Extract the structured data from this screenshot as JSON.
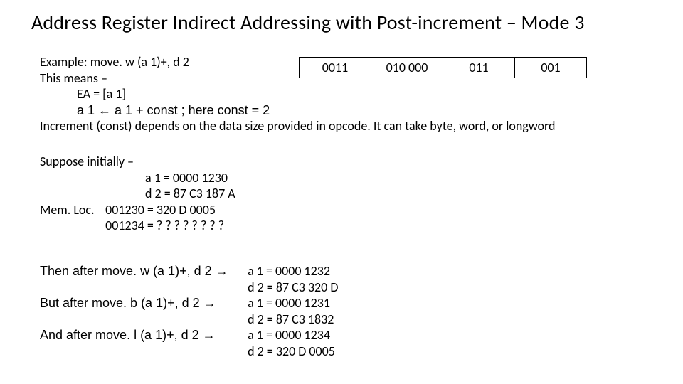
{
  "title": "Address Register Indirect Addressing with Post-increment – Mode 3",
  "example": {
    "line1": "Example:  move. w (a 1)+, d 2",
    "line2": "This means –",
    "ea": "EA = [a 1]",
    "inc": "a 1 ←  a 1 + const   ; here const = 2",
    "desc": "Increment (const) depends on the data size provided in opcode. It can take byte, word, or longword"
  },
  "opcode": {
    "c1": "0011",
    "c2": "010 000",
    "c3": "011",
    "c4": "001"
  },
  "initial": {
    "header": "Suppose initially –",
    "a1": "a 1 = 0000 1230",
    "d2": "d 2 = 87 C3 187 A",
    "memlabel": "Mem. Loc.",
    "mem1": "001230 = 320 D 0005",
    "mem2": "001234 = ? ? ? ?  ? ? ? ?"
  },
  "after": {
    "thenw": "Then after move. w (a 1)+, d 2 →",
    "butb": "But after move. b (a 1)+, d 2 →",
    "andl": "And after move. l (a 1)+, d 2 →",
    "w_a1": "a 1 = 0000 1232",
    "w_d2": "d 2 = 87 C3 320 D",
    "b_a1": "a 1 = 0000 1231",
    "b_d2": "d 2 = 87 C3 1832",
    "l_a1": "a 1 = 0000 1234",
    "l_d2": "d 2 = 320 D 0005"
  }
}
